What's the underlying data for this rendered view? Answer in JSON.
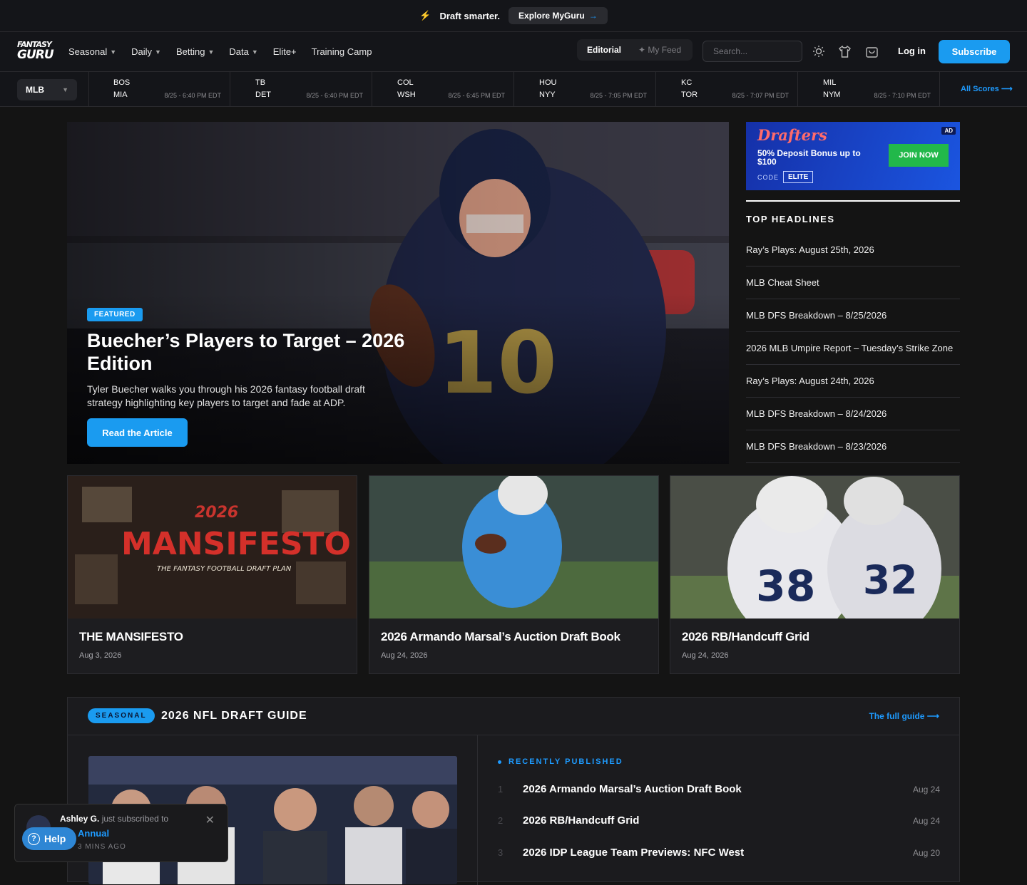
{
  "promo": {
    "text": "Draft smarter.",
    "button": "Explore MyGuru",
    "arrow": "→"
  },
  "nav": {
    "logo_line1": "FANTASY",
    "logo_line2": "GURU",
    "menu": [
      "Seasonal",
      "Daily",
      "Betting",
      "Data",
      "Elite+",
      "Training Camp"
    ],
    "tabs": {
      "editorial": "Editorial",
      "feed": "✦ My Feed"
    },
    "search_placeholder": "Search...",
    "login": "Log in",
    "subscribe": "Subscribe"
  },
  "scores": {
    "league": "MLB",
    "games": [
      {
        "away": "BOS",
        "home": "MIA",
        "time": "8/25 - 6:40 PM EDT"
      },
      {
        "away": "TB",
        "home": "DET",
        "time": "8/25 - 6:40 PM EDT"
      },
      {
        "away": "COL",
        "home": "WSH",
        "time": "8/25 - 6:45 PM EDT"
      },
      {
        "away": "HOU",
        "home": "NYY",
        "time": "8/25 - 7:05 PM EDT"
      },
      {
        "away": "KC",
        "home": "TOR",
        "time": "8/25 - 7:07 PM EDT"
      },
      {
        "away": "MIL",
        "home": "NYM",
        "time": "8/25 - 7:10 PM EDT"
      }
    ],
    "all_scores": "All Scores ⟶"
  },
  "hero": {
    "badge": "FEATURED",
    "title": "Buecher’s Players to Target – 2026 Edition",
    "description": "Tyler Buecher walks you through his 2026 fantasy football draft strategy highlighting key players to target and fade at ADP.",
    "button": "Read the Article"
  },
  "ad": {
    "brand": "Drafters",
    "tag": "AD",
    "offer": "50% Deposit Bonus up to $100",
    "code_label": "CODE",
    "code": "ELITE",
    "button": "JOIN NOW"
  },
  "headlines": {
    "title": "TOP HEADLINES",
    "items": [
      "Ray’s Plays: August 25th, 2026",
      "MLB Cheat Sheet",
      "MLB DFS Breakdown – 8/25/2026",
      "2026 MLB Umpire Report – Tuesday’s Strike Zone",
      "Ray’s Plays: August 24th, 2026",
      "MLB DFS Breakdown – 8/24/2026",
      "MLB DFS Breakdown – 8/23/2026"
    ]
  },
  "cards": [
    {
      "title": "THE MANSIFESTO",
      "date": "Aug 3, 2026",
      "img_text_a": "2026",
      "img_text_b": "MANSIFESTO",
      "img_text_c": "THE FANTASY FOOTBALL DRAFT PLAN"
    },
    {
      "title": "2026 Armando Marsal’s Auction Draft Book",
      "date": "Aug 24, 2026"
    },
    {
      "title": "2026 RB/Handcuff Grid",
      "date": "Aug 24, 2026"
    }
  ],
  "guide": {
    "pill": "SEASONAL",
    "title": "2026 NFL DRAFT GUIDE",
    "full": "The full guide ⟶",
    "recent_label": "RECENTLY PUBLISHED",
    "recent": [
      {
        "n": "1",
        "title": "2026 Armando Marsal’s Auction Draft Book",
        "date": "Aug 24"
      },
      {
        "n": "2",
        "title": "2026 RB/Handcuff Grid",
        "date": "Aug 24"
      },
      {
        "n": "3",
        "title": "2026 IDP League Team Previews: NFC West",
        "date": "Aug 20"
      }
    ]
  },
  "toast": {
    "name": "Ashley G.",
    "text": "just subscribed to",
    "plan": "Annual",
    "ago": "3 MINS AGO",
    "close": "✕"
  },
  "help": {
    "label": "Help"
  },
  "colors": {
    "accent": "#1a9bf0",
    "background": "#141414",
    "ad_green": "#22b84a"
  }
}
